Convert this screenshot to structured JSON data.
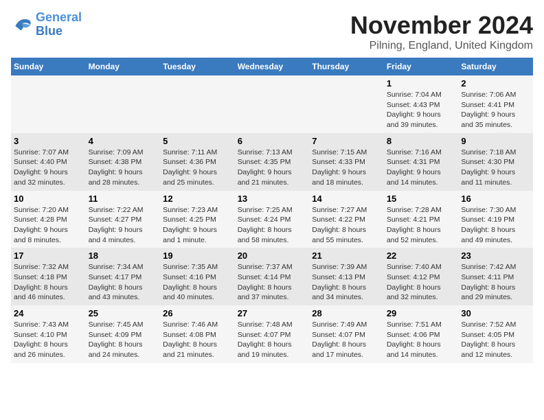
{
  "logo": {
    "line1": "General",
    "line2": "Blue"
  },
  "title": "November 2024",
  "subtitle": "Pilning, England, United Kingdom",
  "days_of_week": [
    "Sunday",
    "Monday",
    "Tuesday",
    "Wednesday",
    "Thursday",
    "Friday",
    "Saturday"
  ],
  "weeks": [
    [
      {
        "day": "",
        "info": ""
      },
      {
        "day": "",
        "info": ""
      },
      {
        "day": "",
        "info": ""
      },
      {
        "day": "",
        "info": ""
      },
      {
        "day": "",
        "info": ""
      },
      {
        "day": "1",
        "info": "Sunrise: 7:04 AM\nSunset: 4:43 PM\nDaylight: 9 hours\nand 39 minutes."
      },
      {
        "day": "2",
        "info": "Sunrise: 7:06 AM\nSunset: 4:41 PM\nDaylight: 9 hours\nand 35 minutes."
      }
    ],
    [
      {
        "day": "3",
        "info": "Sunrise: 7:07 AM\nSunset: 4:40 PM\nDaylight: 9 hours\nand 32 minutes."
      },
      {
        "day": "4",
        "info": "Sunrise: 7:09 AM\nSunset: 4:38 PM\nDaylight: 9 hours\nand 28 minutes."
      },
      {
        "day": "5",
        "info": "Sunrise: 7:11 AM\nSunset: 4:36 PM\nDaylight: 9 hours\nand 25 minutes."
      },
      {
        "day": "6",
        "info": "Sunrise: 7:13 AM\nSunset: 4:35 PM\nDaylight: 9 hours\nand 21 minutes."
      },
      {
        "day": "7",
        "info": "Sunrise: 7:15 AM\nSunset: 4:33 PM\nDaylight: 9 hours\nand 18 minutes."
      },
      {
        "day": "8",
        "info": "Sunrise: 7:16 AM\nSunset: 4:31 PM\nDaylight: 9 hours\nand 14 minutes."
      },
      {
        "day": "9",
        "info": "Sunrise: 7:18 AM\nSunset: 4:30 PM\nDaylight: 9 hours\nand 11 minutes."
      }
    ],
    [
      {
        "day": "10",
        "info": "Sunrise: 7:20 AM\nSunset: 4:28 PM\nDaylight: 9 hours\nand 8 minutes."
      },
      {
        "day": "11",
        "info": "Sunrise: 7:22 AM\nSunset: 4:27 PM\nDaylight: 9 hours\nand 4 minutes."
      },
      {
        "day": "12",
        "info": "Sunrise: 7:23 AM\nSunset: 4:25 PM\nDaylight: 9 hours\nand 1 minute."
      },
      {
        "day": "13",
        "info": "Sunrise: 7:25 AM\nSunset: 4:24 PM\nDaylight: 8 hours\nand 58 minutes."
      },
      {
        "day": "14",
        "info": "Sunrise: 7:27 AM\nSunset: 4:22 PM\nDaylight: 8 hours\nand 55 minutes."
      },
      {
        "day": "15",
        "info": "Sunrise: 7:28 AM\nSunset: 4:21 PM\nDaylight: 8 hours\nand 52 minutes."
      },
      {
        "day": "16",
        "info": "Sunrise: 7:30 AM\nSunset: 4:19 PM\nDaylight: 8 hours\nand 49 minutes."
      }
    ],
    [
      {
        "day": "17",
        "info": "Sunrise: 7:32 AM\nSunset: 4:18 PM\nDaylight: 8 hours\nand 46 minutes."
      },
      {
        "day": "18",
        "info": "Sunrise: 7:34 AM\nSunset: 4:17 PM\nDaylight: 8 hours\nand 43 minutes."
      },
      {
        "day": "19",
        "info": "Sunrise: 7:35 AM\nSunset: 4:16 PM\nDaylight: 8 hours\nand 40 minutes."
      },
      {
        "day": "20",
        "info": "Sunrise: 7:37 AM\nSunset: 4:14 PM\nDaylight: 8 hours\nand 37 minutes."
      },
      {
        "day": "21",
        "info": "Sunrise: 7:39 AM\nSunset: 4:13 PM\nDaylight: 8 hours\nand 34 minutes."
      },
      {
        "day": "22",
        "info": "Sunrise: 7:40 AM\nSunset: 4:12 PM\nDaylight: 8 hours\nand 32 minutes."
      },
      {
        "day": "23",
        "info": "Sunrise: 7:42 AM\nSunset: 4:11 PM\nDaylight: 8 hours\nand 29 minutes."
      }
    ],
    [
      {
        "day": "24",
        "info": "Sunrise: 7:43 AM\nSunset: 4:10 PM\nDaylight: 8 hours\nand 26 minutes."
      },
      {
        "day": "25",
        "info": "Sunrise: 7:45 AM\nSunset: 4:09 PM\nDaylight: 8 hours\nand 24 minutes."
      },
      {
        "day": "26",
        "info": "Sunrise: 7:46 AM\nSunset: 4:08 PM\nDaylight: 8 hours\nand 21 minutes."
      },
      {
        "day": "27",
        "info": "Sunrise: 7:48 AM\nSunset: 4:07 PM\nDaylight: 8 hours\nand 19 minutes."
      },
      {
        "day": "28",
        "info": "Sunrise: 7:49 AM\nSunset: 4:07 PM\nDaylight: 8 hours\nand 17 minutes."
      },
      {
        "day": "29",
        "info": "Sunrise: 7:51 AM\nSunset: 4:06 PM\nDaylight: 8 hours\nand 14 minutes."
      },
      {
        "day": "30",
        "info": "Sunrise: 7:52 AM\nSunset: 4:05 PM\nDaylight: 8 hours\nand 12 minutes."
      }
    ]
  ]
}
